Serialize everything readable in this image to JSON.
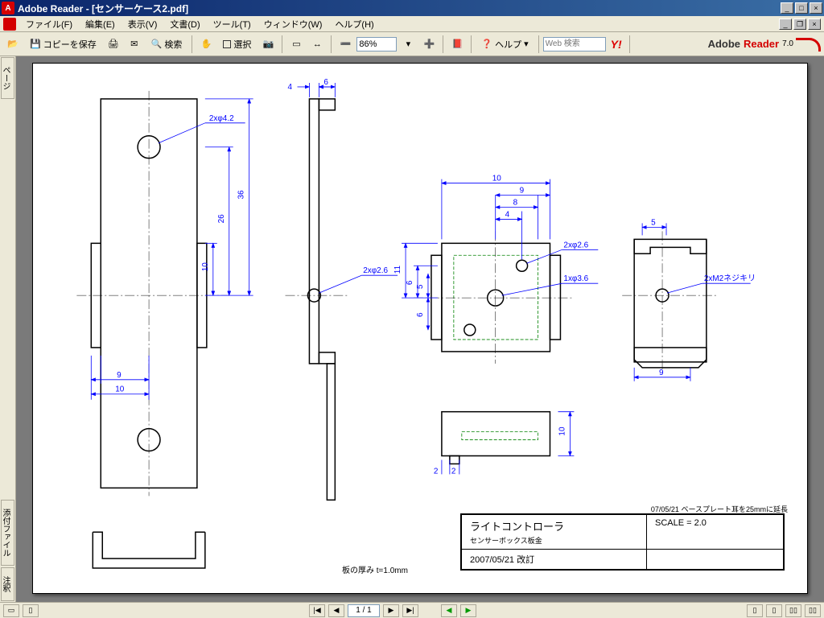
{
  "titlebar": {
    "app": "Adobe Reader",
    "doc": "[センサーケース2.pdf]",
    "min": "_",
    "max": "□",
    "close": "×"
  },
  "menu": {
    "file": "ファイル(F)",
    "edit": "編集(E)",
    "view": "表示(V)",
    "doc": "文書(D)",
    "tool": "ツール(T)",
    "window": "ウィンドウ(W)",
    "help": "ヘルプ(H)"
  },
  "toolbar": {
    "save": "コピーを保存",
    "search": "検索",
    "select": "選択",
    "zoom": "86%",
    "help": "ヘルプ",
    "websearch": "Web 検索"
  },
  "brand": {
    "adobe": "Adobe",
    "reader": "Reader",
    "ver": "7.0"
  },
  "sidetabs": {
    "pages": "ページ",
    "attach": "添付ファイル",
    "comment": "注釈"
  },
  "drawing": {
    "callouts": {
      "hole1": "2xφ4.2",
      "hole2": "2xφ2.6",
      "hole3": "2xφ2.6",
      "hole4": "1xφ3.6",
      "hole5": "2xM2ネジキリ"
    },
    "dims": {
      "d4": "4",
      "d6": "6",
      "d36": "36",
      "d26": "26",
      "d10": "10",
      "d9": "9",
      "d10b": "10",
      "d11": "11",
      "d5": "5",
      "d6b": "6",
      "d8": "8",
      "d2": "2",
      "d2b": "2",
      "d5b": "5",
      "d9b": "9",
      "d4b": "4",
      "d6c": "6",
      "d10c": "10"
    },
    "notes": {
      "thickness": "板の厚み t=1.0mm",
      "rev": "07/05/21 ベースプレート耳を25mmに延長"
    },
    "titleblock": {
      "name": "ライトコントローラ",
      "sub": "センサーボックス板金",
      "date": "2007/05/21 改訂",
      "scale": "SCALE = 2.0"
    }
  },
  "statusbar": {
    "page": "1 / 1"
  }
}
